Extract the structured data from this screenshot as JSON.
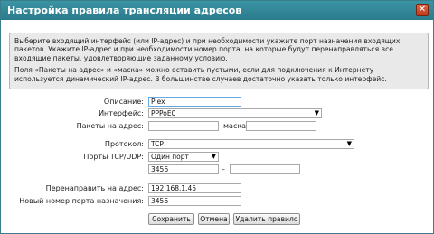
{
  "dialog": {
    "title": "Настройка правила трансляции адресов",
    "close_glyph": "✕"
  },
  "info": {
    "paragraph1": "Выберите входящий интерфейс (или IP-адрес) и при необходимости укажите порт назначения входящих пакетов. Укажите IP-адрес и при необходимости номер порта, на которые будут перенаправляться все входящие пакеты, удовлетворяющие заданному условию.",
    "paragraph2": "Поля «Пакеты на адрес» и «маска» можно оставить пустыми, если для подключения к Интернету используется динамический IP-адрес. В большинстве случаев достаточно указать только интерфейс."
  },
  "form": {
    "description_label": "Описание:",
    "description_value": "Plex",
    "interface_label": "Интерфейс:",
    "interface_value": "PPPoE0",
    "packets_to_address_label": "Пакеты на адрес:",
    "packets_to_address_value": "",
    "mask_label": "маска:",
    "mask_value": "",
    "protocol_label": "Протокол:",
    "protocol_value": "TCP",
    "ports_label": "Порты TCP/UDP:",
    "ports_mode_value": "Один порт",
    "port_from_value": "3456",
    "port_range_dash": "–",
    "port_to_value": "",
    "redirect_label": "Перенаправить на адрес:",
    "redirect_value": "192.168.1.45",
    "new_port_label": "Новый номер порта назначения:",
    "new_port_value": "3456"
  },
  "buttons": {
    "save": "Сохранить",
    "cancel": "Отмена",
    "delete": "Удалить правило"
  },
  "colors": {
    "titlebar": "#2b7b8c",
    "close_button": "#c0391b",
    "info_background": "#e9e9e9"
  }
}
